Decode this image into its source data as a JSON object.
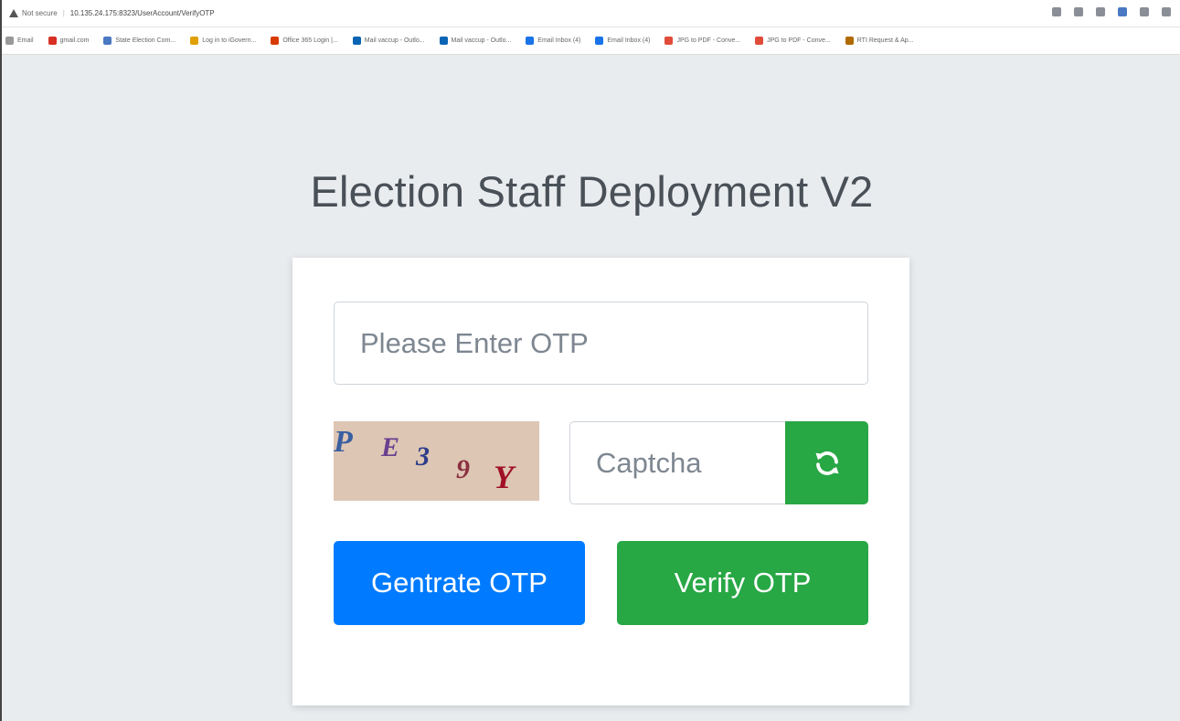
{
  "browser": {
    "security_label": "Not secure",
    "url": "10.135.24.175:8323/UserAccount/VerifyOTP",
    "bookmarks": [
      {
        "label": "Email",
        "color": "#999999"
      },
      {
        "label": "gmail.com",
        "color": "#d93025"
      },
      {
        "label": "State Election Com...",
        "color": "#4a78c2"
      },
      {
        "label": "Log in to iGovern...",
        "color": "#e0a000"
      },
      {
        "label": "Office 365 Login |...",
        "color": "#d83b01"
      },
      {
        "label": "Mail vaccup - Outlo...",
        "color": "#0a64b4"
      },
      {
        "label": "Mail vaccup - Outlo...",
        "color": "#0a64b4"
      },
      {
        "label": "Email Inbox (4)",
        "color": "#1a73e8"
      },
      {
        "label": "Email Inbox (4)",
        "color": "#1a73e8"
      },
      {
        "label": "JPG to PDF - Conve...",
        "color": "#e04b3a"
      },
      {
        "label": "JPG to PDF - Conve...",
        "color": "#e04b3a"
      },
      {
        "label": "RTI Request & Ap...",
        "color": "#b06a00"
      }
    ]
  },
  "page": {
    "title": "Election Staff Deployment V2"
  },
  "form": {
    "otp_placeholder": "Please Enter OTP",
    "captcha_placeholder": "Captcha",
    "captcha_text": [
      "P",
      "E",
      "3",
      "9",
      "Y"
    ],
    "refresh_icon": "refresh-icon",
    "generate_label": "Gentrate OTP",
    "verify_label": "Verify OTP"
  },
  "colors": {
    "primary": "#007bff",
    "success": "#28a745",
    "background": "#e9ecef"
  }
}
